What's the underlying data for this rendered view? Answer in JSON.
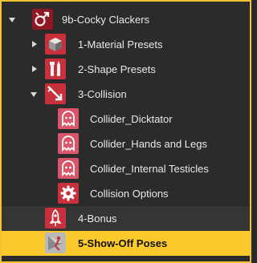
{
  "tree": {
    "items": [
      {
        "label": "9b-Cocky Clackers",
        "icon": "gender-symbol-icon",
        "expanded": true
      },
      {
        "label": "1-Material Presets",
        "icon": "cube-icon",
        "expanded": false
      },
      {
        "label": "2-Shape Presets",
        "icon": "tools-icon",
        "expanded": false
      },
      {
        "label": "3-Collision",
        "icon": "collision-arrow-icon",
        "expanded": true
      },
      {
        "label": "Collider_Dicktator",
        "icon": "ghost-icon"
      },
      {
        "label": "Collider_Hands and Legs",
        "icon": "ghost-icon"
      },
      {
        "label": "Collider_Internal Testicles",
        "icon": "ghost-icon"
      },
      {
        "label": "Collision Options",
        "icon": "gear-icon"
      },
      {
        "label": "4-Bonus",
        "icon": "rocket-icon"
      },
      {
        "label": "5-Show-Off Poses",
        "icon": "pose-figure-icon",
        "selected": true
      }
    ]
  },
  "colors": {
    "selection": "#fbc92c",
    "border": "#f3c431",
    "icon_red": "#c8303b",
    "icon_pink": "#d9556a"
  }
}
